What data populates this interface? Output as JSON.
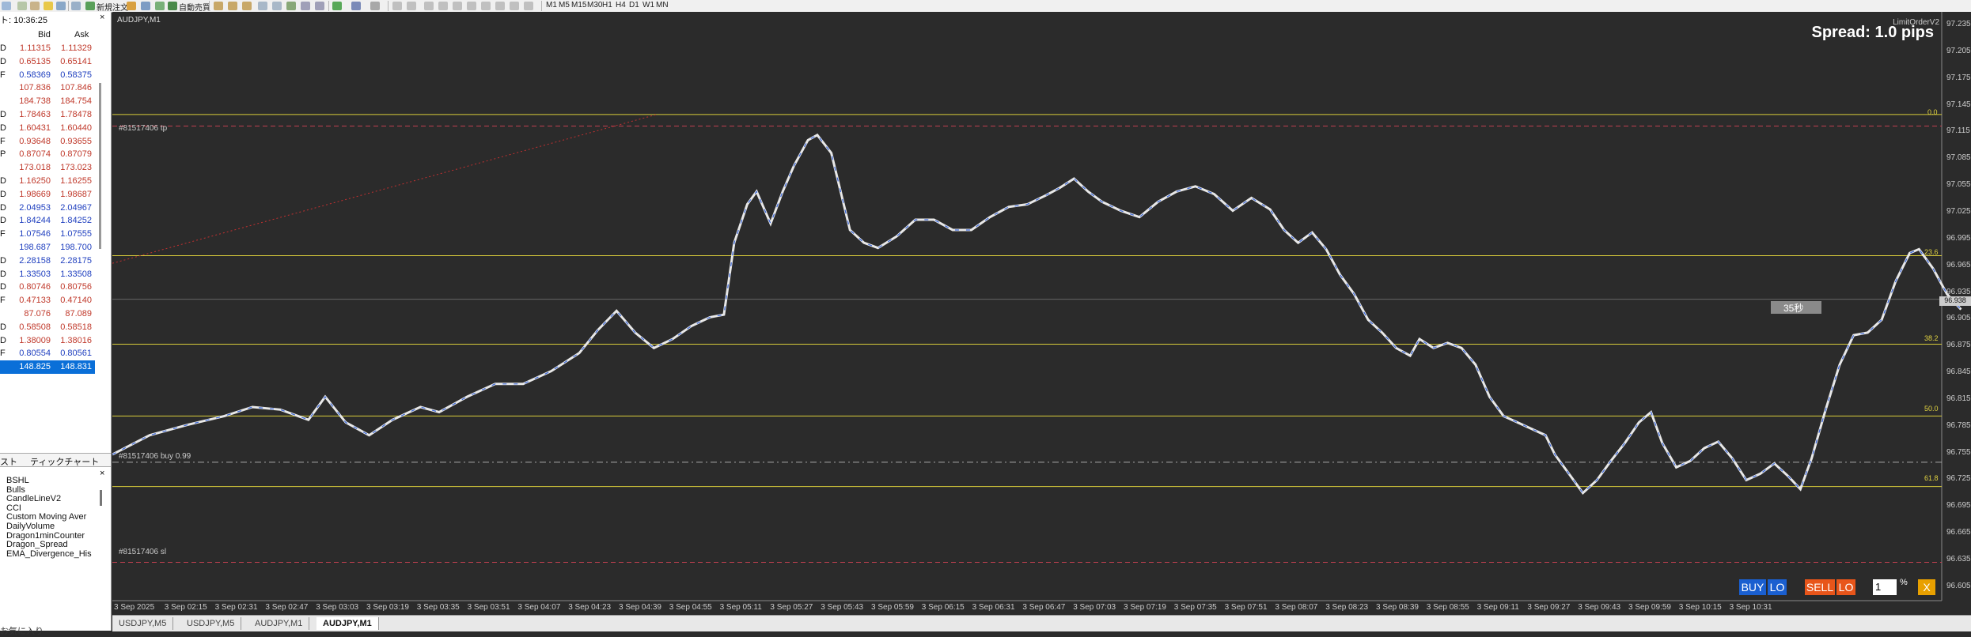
{
  "toolbar": {
    "new_order": "新規注文",
    "autotrade": "自動売買",
    "timeframes": [
      "M1",
      "M5",
      "M15",
      "M30",
      "H1",
      "H4",
      "D1",
      "W1",
      "MN"
    ]
  },
  "market_watch": {
    "time": "ト: 10:36:25",
    "close": "×",
    "bid_header": "Bid",
    "ask_header": "Ask",
    "rows": [
      {
        "sym": "D",
        "bid": "1.11315",
        "ask": "1.11329",
        "color": "#c0392b"
      },
      {
        "sym": "D",
        "bid": "0.65135",
        "ask": "0.65141",
        "color": "#c0392b"
      },
      {
        "sym": "F",
        "bid": "0.58369",
        "ask": "0.58375",
        "color": "#1f3fbf"
      },
      {
        "sym": "",
        "bid": "107.836",
        "ask": "107.846",
        "color": "#c0392b"
      },
      {
        "sym": "",
        "bid": "184.738",
        "ask": "184.754",
        "color": "#c0392b"
      },
      {
        "sym": "D",
        "bid": "1.78463",
        "ask": "1.78478",
        "color": "#c0392b"
      },
      {
        "sym": "D",
        "bid": "1.60431",
        "ask": "1.60440",
        "color": "#c0392b"
      },
      {
        "sym": "F",
        "bid": "0.93648",
        "ask": "0.93655",
        "color": "#c0392b"
      },
      {
        "sym": "P",
        "bid": "0.87074",
        "ask": "0.87079",
        "color": "#c0392b"
      },
      {
        "sym": "",
        "bid": "173.018",
        "ask": "173.023",
        "color": "#c0392b"
      },
      {
        "sym": "D",
        "bid": "1.16250",
        "ask": "1.16255",
        "color": "#c0392b"
      },
      {
        "sym": "D",
        "bid": "1.98669",
        "ask": "1.98687",
        "color": "#c0392b"
      },
      {
        "sym": "D",
        "bid": "2.04953",
        "ask": "2.04967",
        "color": "#1f3fbf"
      },
      {
        "sym": "D",
        "bid": "1.84244",
        "ask": "1.84252",
        "color": "#1f3fbf"
      },
      {
        "sym": "F",
        "bid": "1.07546",
        "ask": "1.07555",
        "color": "#1f3fbf"
      },
      {
        "sym": "",
        "bid": "198.687",
        "ask": "198.700",
        "color": "#1f3fbf"
      },
      {
        "sym": "D",
        "bid": "2.28158",
        "ask": "2.28175",
        "color": "#1f3fbf"
      },
      {
        "sym": "D",
        "bid": "1.33503",
        "ask": "1.33508",
        "color": "#1f3fbf"
      },
      {
        "sym": "D",
        "bid": "0.80746",
        "ask": "0.80756",
        "color": "#c0392b"
      },
      {
        "sym": "F",
        "bid": "0.47133",
        "ask": "0.47140",
        "color": "#c0392b"
      },
      {
        "sym": "",
        "bid": "87.076",
        "ask": "87.089",
        "color": "#c0392b"
      },
      {
        "sym": "D",
        "bid": "0.58508",
        "ask": "0.58518",
        "color": "#c0392b"
      },
      {
        "sym": "D",
        "bid": "1.38009",
        "ask": "1.38016",
        "color": "#c0392b"
      },
      {
        "sym": "F",
        "bid": "0.80554",
        "ask": "0.80561",
        "color": "#1f3fbf"
      },
      {
        "sym": "",
        "bid": "148.825",
        "ask": "148.831",
        "color": "#ffffff",
        "selected": true
      }
    ],
    "tab_list": "スト",
    "tab_tick": "ティックチャート"
  },
  "navigator": {
    "close": "×",
    "items": [
      "BSHL",
      "Bulls",
      "CandleLineV2",
      "CCI",
      "Custom Moving Aver",
      "DailyVolume",
      "Dragon1minCounter",
      "Dragon_Spread",
      "EMA_Divergence_His"
    ],
    "favorites": "お気に入り"
  },
  "chart": {
    "title": "AUDJPY,M1",
    "indicator": "LimitOrderV2",
    "spread": "Spread: 1.0 pips",
    "tp_label": "#81517406 tp",
    "buy_label": "#81517406 buy 0.99",
    "sl_label": "#81517406 sl",
    "fib_levels": [
      "0.0",
      "23.6",
      "38.2",
      "50.0",
      "61.8"
    ],
    "current_price": "96.938",
    "countdown": "35秒",
    "price_labels": [
      "97.235",
      "97.205",
      "97.175",
      "97.145",
      "97.115",
      "97.085",
      "97.055",
      "97.025",
      "96.995",
      "96.965",
      "96.935",
      "96.905",
      "96.875",
      "96.845",
      "96.815",
      "96.785",
      "96.755",
      "96.725",
      "96.695",
      "96.665",
      "96.635",
      "96.605"
    ],
    "time_labels": [
      "3 Sep 2025",
      "3 Sep 02:15",
      "3 Sep 02:31",
      "3 Sep 02:47",
      "3 Sep 03:03",
      "3 Sep 03:19",
      "3 Sep 03:35",
      "3 Sep 03:51",
      "3 Sep 04:07",
      "3 Sep 04:23",
      "3 Sep 04:39",
      "3 Sep 04:55",
      "3 Sep 05:11",
      "3 Sep 05:27",
      "3 Sep 05:43",
      "3 Sep 05:59",
      "3 Sep 06:15",
      "3 Sep 06:31",
      "3 Sep 06:47",
      "3 Sep 07:03",
      "3 Sep 07:19",
      "3 Sep 07:35",
      "3 Sep 07:51",
      "3 Sep 08:07",
      "3 Sep 08:23",
      "3 Sep 08:39",
      "3 Sep 08:55",
      "3 Sep 09:11",
      "3 Sep 09:27",
      "3 Sep 09:43",
      "3 Sep 09:59",
      "3 Sep 10:15",
      "3 Sep 10:31"
    ],
    "panel": {
      "buy": "BUY",
      "lo1": "LO",
      "sell": "SELL",
      "lo2": "LO",
      "lot": "1",
      "pct": "%",
      "close": "X"
    }
  },
  "bottom_tabs": [
    "USDJPY,M5",
    "USDJPY,M5",
    "AUDJPY,M1",
    "AUDJPY,M1"
  ]
}
